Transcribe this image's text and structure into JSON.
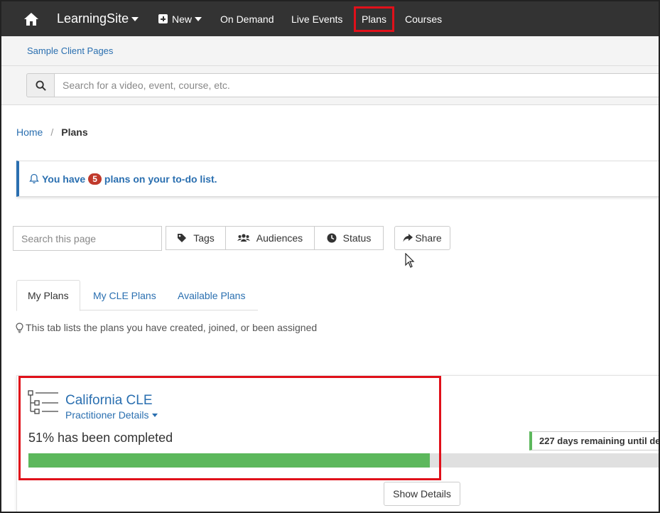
{
  "nav": {
    "brand": "LearningSite",
    "new_label": "New",
    "on_demand": "On Demand",
    "live_events": "Live Events",
    "plans": "Plans",
    "courses": "Courses"
  },
  "subbar": {
    "link": "Sample Client Pages"
  },
  "search": {
    "placeholder": "Search for a video, event, course, etc."
  },
  "breadcrumb": {
    "home": "Home",
    "current": "Plans"
  },
  "alert": {
    "prefix": "You have",
    "count": "5",
    "suffix": "plans on your to-do list."
  },
  "filters": {
    "search_placeholder": "Search this page",
    "tags": "Tags",
    "audiences": "Audiences",
    "status": "Status",
    "share": "Share"
  },
  "tabs": [
    {
      "label": "My Plans",
      "active": true
    },
    {
      "label": "My CLE Plans",
      "active": false
    },
    {
      "label": "Available Plans",
      "active": false
    }
  ],
  "hint": "This tab lists the plans you have created, joined, or been assigned",
  "plan": {
    "title": "California CLE",
    "subtitle": "Practitioner Details",
    "progress_text": "51% has been completed",
    "progress_value": 0.51,
    "remaining": "227 days remaining until de",
    "show_details": "Show Details"
  },
  "colors": {
    "nav_bg": "#333333",
    "link": "#2a6fb0",
    "highlight": "#e0101a",
    "progress": "#5cb85c",
    "badge": "#c0392b"
  }
}
